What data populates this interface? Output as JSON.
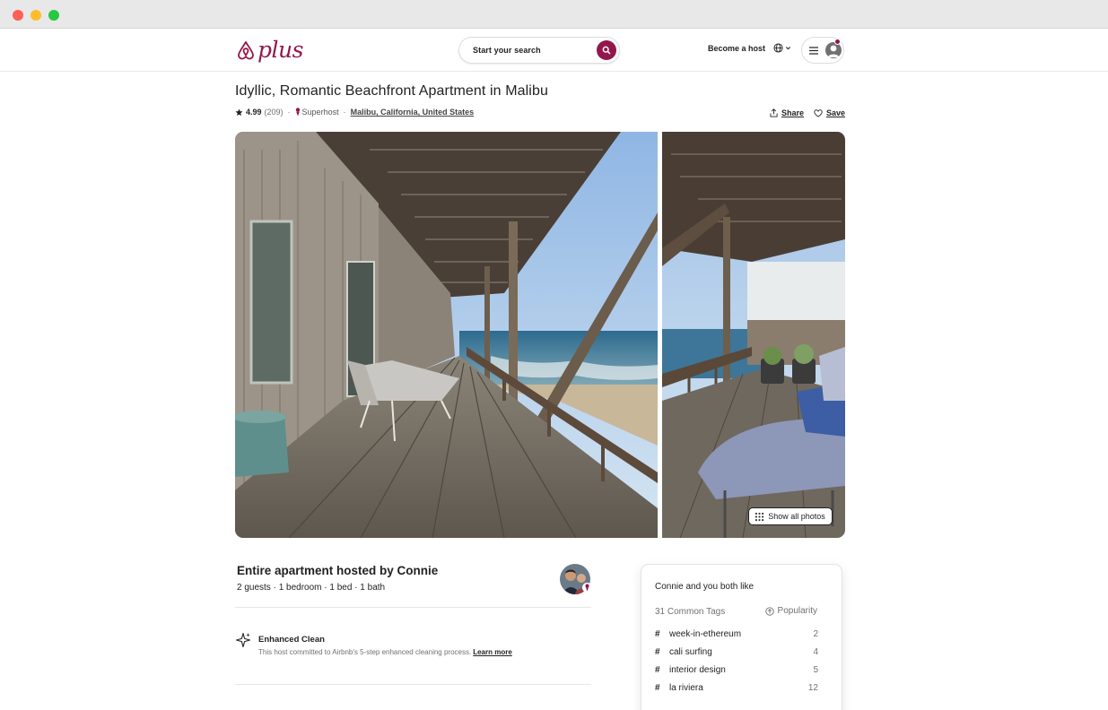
{
  "brand": {
    "name": "plus",
    "accent": "#92174d"
  },
  "header": {
    "search_placeholder": "Start your search",
    "become_host": "Become a host"
  },
  "listing": {
    "title": "Idyllic, Romantic Beachfront Apartment in Malibu",
    "rating": "4.99",
    "review_count": "(209)",
    "superhost": "Superhost",
    "location": "Malibu, California, United States",
    "share": "Share",
    "save": "Save",
    "show_all_photos": "Show all photos"
  },
  "host": {
    "title": "Entire apartment hosted by Connie",
    "details": "2 guests · 1 bedroom · 1 bed · 1 bath"
  },
  "highlight": {
    "title": "Enhanced Clean",
    "description": "This host committed to Airbnb's 5-step enhanced cleaning process.",
    "link": "Learn more"
  },
  "common": {
    "title": "Connie and you both like",
    "subtitle": "31 Common Tags",
    "sort": "Popularity",
    "tags": [
      {
        "name": "week-in-ethereum",
        "count": "2"
      },
      {
        "name": "cali surfing",
        "count": "4"
      },
      {
        "name": "interior design",
        "count": "5"
      },
      {
        "name": "la riviera",
        "count": "12"
      }
    ]
  },
  "icons": [
    "airbnb-logo-icon",
    "search-icon",
    "globe-icon",
    "chevron-down-icon",
    "menu-icon",
    "user-icon",
    "star-icon",
    "superhost-icon",
    "share-icon",
    "heart-icon",
    "grid-icon",
    "sparkle-icon",
    "popularity-icon",
    "hash-icon"
  ]
}
